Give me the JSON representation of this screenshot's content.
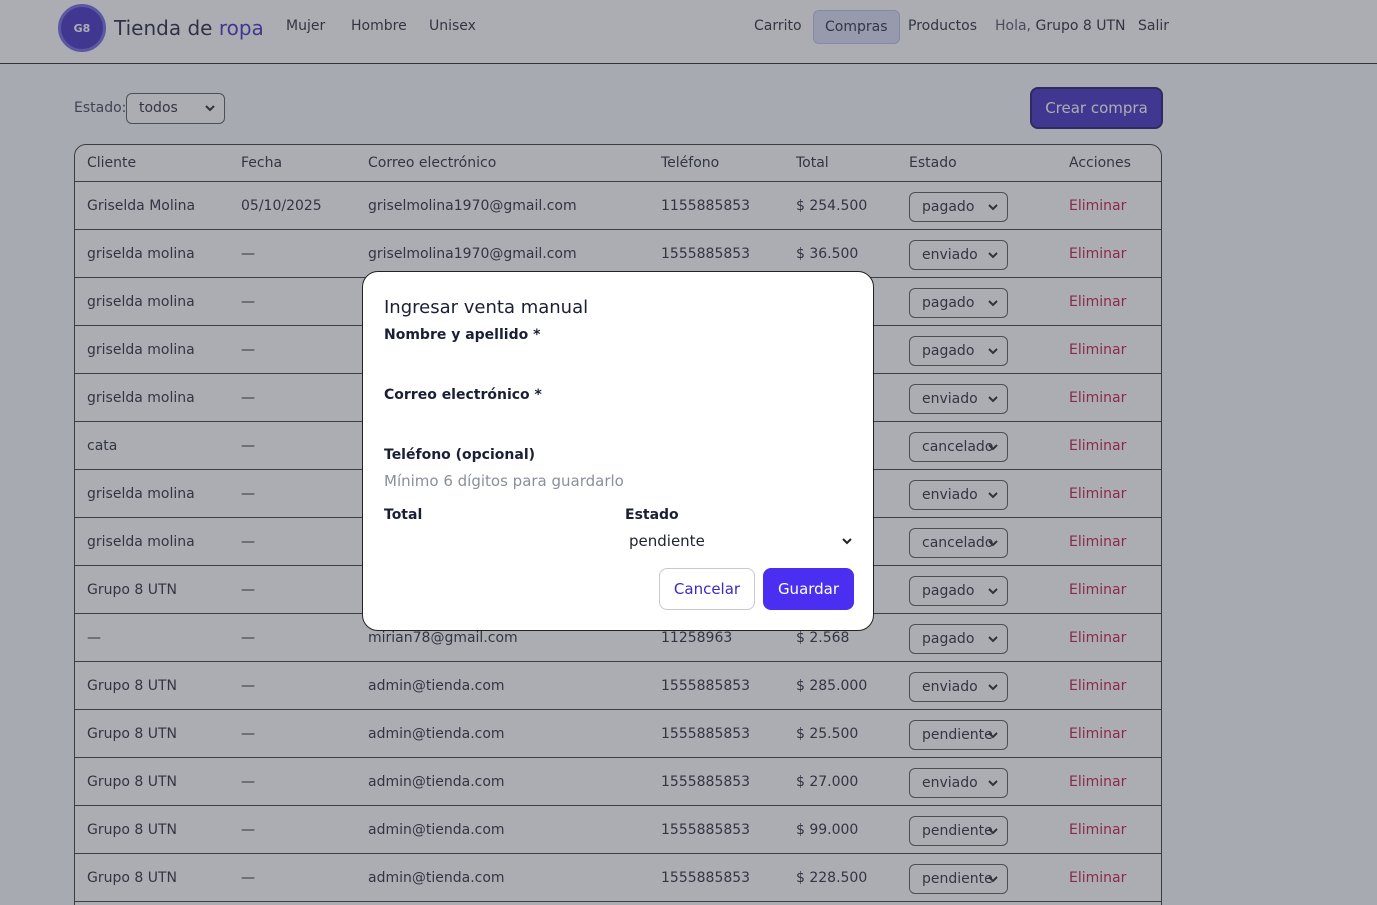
{
  "header": {
    "logo_text": "G8",
    "brand_prefix": "Tienda de",
    "brand_accent": "ropa",
    "nav_left": [
      "Mujer",
      "Hombre",
      "Unisex"
    ],
    "nav_carrito": "Carrito",
    "nav_compras": "Compras",
    "nav_productos": "Productos",
    "greeting_prefix": "Hola,",
    "greeting_user": "Grupo 8 UTN",
    "logout": "Salir"
  },
  "toolbar": {
    "estado_label": "Estado:",
    "estado_value": "todos",
    "create_button": "Crear compra"
  },
  "table": {
    "headers": [
      "Cliente",
      "Fecha",
      "Correo electrónico",
      "Teléfono",
      "Total",
      "Estado",
      "Acciones"
    ],
    "delete_label": "Eliminar",
    "rows": [
      {
        "cliente": "Griselda Molina",
        "fecha": "05/10/2025",
        "correo": "griselmolina1970@gmail.com",
        "telefono": "1155885853",
        "total": "$ 254.500",
        "estado": "pagado"
      },
      {
        "cliente": "griselda molina",
        "fecha": "—",
        "correo": "griselmolina1970@gmail.com",
        "telefono": "1555885853",
        "total": "$ 36.500",
        "estado": "enviado"
      },
      {
        "cliente": "griselda molina",
        "fecha": "—",
        "correo": "",
        "telefono": "",
        "total": "",
        "estado": "pagado"
      },
      {
        "cliente": "griselda molina",
        "fecha": "—",
        "correo": "",
        "telefono": "",
        "total": "",
        "estado": "pagado"
      },
      {
        "cliente": "griselda molina",
        "fecha": "—",
        "correo": "",
        "telefono": "",
        "total": "",
        "estado": "enviado"
      },
      {
        "cliente": "cata",
        "fecha": "—",
        "correo": "",
        "telefono": "",
        "total": "",
        "estado": "cancelado"
      },
      {
        "cliente": "griselda molina",
        "fecha": "—",
        "correo": "",
        "telefono": "",
        "total": "",
        "estado": "enviado"
      },
      {
        "cliente": "griselda molina",
        "fecha": "—",
        "correo": "",
        "telefono": "",
        "total": "",
        "estado": "cancelado"
      },
      {
        "cliente": "Grupo 8 UTN",
        "fecha": "—",
        "correo": "",
        "telefono": "",
        "total": "",
        "estado": "pagado"
      },
      {
        "cliente": "—",
        "fecha": "—",
        "correo": "mirian78@gmail.com",
        "telefono": "11258963",
        "total": "$ 2.568",
        "estado": "pagado"
      },
      {
        "cliente": "Grupo 8 UTN",
        "fecha": "—",
        "correo": "admin@tienda.com",
        "telefono": "1555885853",
        "total": "$ 285.000",
        "estado": "enviado"
      },
      {
        "cliente": "Grupo 8 UTN",
        "fecha": "—",
        "correo": "admin@tienda.com",
        "telefono": "1555885853",
        "total": "$ 25.500",
        "estado": "pendiente"
      },
      {
        "cliente": "Grupo 8 UTN",
        "fecha": "—",
        "correo": "admin@tienda.com",
        "telefono": "1555885853",
        "total": "$ 27.000",
        "estado": "enviado"
      },
      {
        "cliente": "Grupo 8 UTN",
        "fecha": "—",
        "correo": "admin@tienda.com",
        "telefono": "1555885853",
        "total": "$ 99.000",
        "estado": "pendiente"
      },
      {
        "cliente": "Grupo 8 UTN",
        "fecha": "—",
        "correo": "admin@tienda.com",
        "telefono": "1555885853",
        "total": "$ 228.500",
        "estado": "pendiente"
      }
    ]
  },
  "modal": {
    "title": "Ingresar venta manual",
    "name_label": "Nombre y apellido *",
    "name_value": "",
    "email_label": "Correo electrónico *",
    "email_value": "",
    "phone_label": "Teléfono (opcional)",
    "phone_placeholder": "Mínimo 6 dígitos para guardarlo",
    "total_label": "Total",
    "total_value": "",
    "estado_label": "Estado",
    "estado_value": "pendiente",
    "cancel_button": "Cancelar",
    "save_button": "Guardar"
  },
  "colors": {
    "accent": "#3b2bbf",
    "save_button": "#4a2ff0",
    "delete_link": "#c0123c"
  }
}
